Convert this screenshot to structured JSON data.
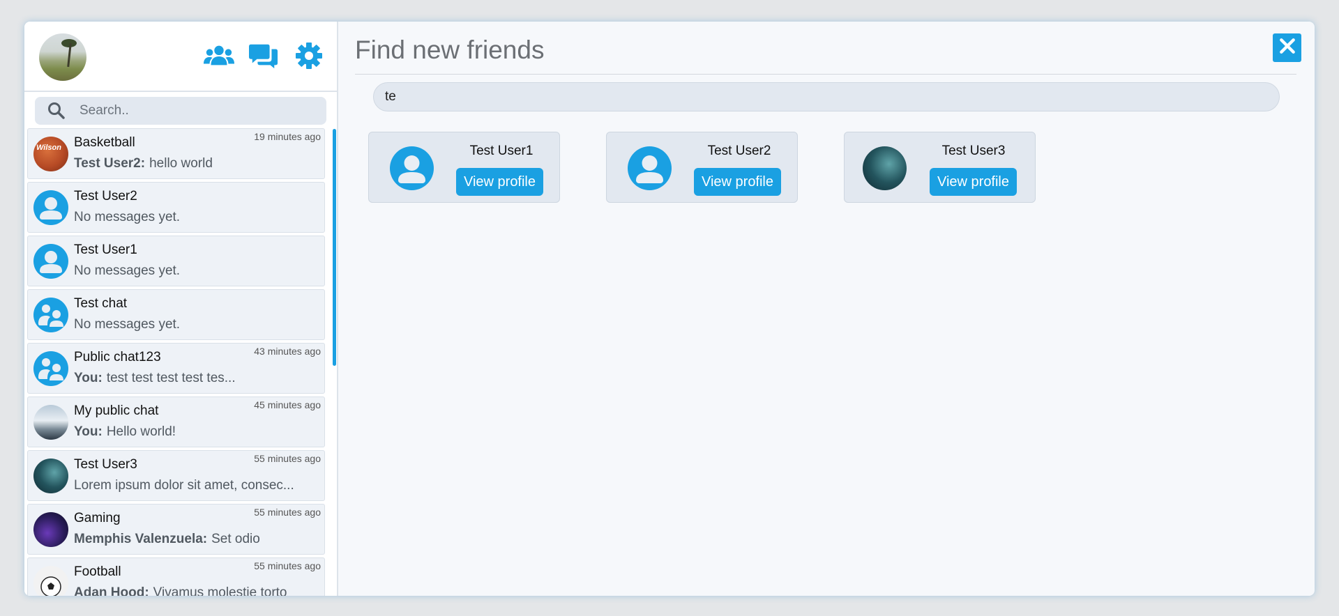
{
  "sidebar": {
    "search_placeholder": "Search..",
    "chats": [
      {
        "name": "Basketball",
        "time": "19 minutes ago",
        "sender": "Test User2:",
        "message": "hello world",
        "avatar": "basketball-photo"
      },
      {
        "name": "Test User2",
        "time": "",
        "sender": "",
        "message": "No messages yet.",
        "avatar": "user-icon"
      },
      {
        "name": "Test User1",
        "time": "",
        "sender": "",
        "message": "No messages yet.",
        "avatar": "user-icon"
      },
      {
        "name": "Test chat",
        "time": "",
        "sender": "",
        "message": "No messages yet.",
        "avatar": "group-icon"
      },
      {
        "name": "Public chat123",
        "time": "43 minutes ago",
        "sender": "You:",
        "message": "test test test test tes...",
        "avatar": "group-icon"
      },
      {
        "name": "My public chat",
        "time": "45 minutes ago",
        "sender": "You:",
        "message": "Hello world!",
        "avatar": "mountain-photo"
      },
      {
        "name": "Test User3",
        "time": "55 minutes ago",
        "sender": "",
        "message": "Lorem ipsum dolor sit amet, consec...",
        "avatar": "ocean-photo"
      },
      {
        "name": "Gaming",
        "time": "55 minutes ago",
        "sender": "Memphis Valenzuela:",
        "message": "Set odio",
        "avatar": "gaming-photo"
      },
      {
        "name": "Football",
        "time": "55 minutes ago",
        "sender": "Adan Hood:",
        "message": "Vivamus molestie torto",
        "avatar": "football-photo"
      }
    ]
  },
  "main": {
    "title": "Find new friends",
    "search_value": "te",
    "results": [
      {
        "name": "Test User1",
        "button": "View profile",
        "avatar": "user-icon"
      },
      {
        "name": "Test User2",
        "button": "View profile",
        "avatar": "user-icon"
      },
      {
        "name": "Test User3",
        "button": "View profile",
        "avatar": "ocean-photo"
      }
    ]
  },
  "colors": {
    "accent": "#1aa0e2",
    "card_bg": "#e2e8f0",
    "panel_bg": "#f6f8fb"
  },
  "icons": {
    "header": [
      "friends-icon",
      "chats-icon",
      "settings-icon"
    ],
    "close": "close-icon",
    "search": "search-icon"
  }
}
